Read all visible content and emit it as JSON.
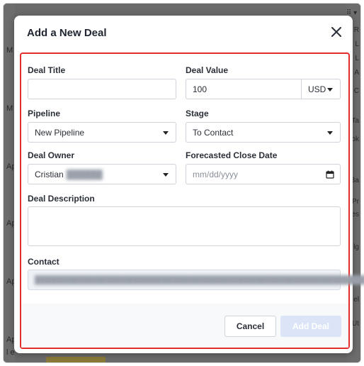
{
  "modal": {
    "title": "Add a New Deal"
  },
  "form": {
    "deal_title": {
      "label": "Deal Title",
      "value": ""
    },
    "deal_value": {
      "label": "Deal Value",
      "value": "100",
      "currency": "USD"
    },
    "pipeline": {
      "label": "Pipeline",
      "value": "New Pipeline"
    },
    "stage": {
      "label": "Stage",
      "value": "To Contact"
    },
    "deal_owner": {
      "label": "Deal Owner",
      "value": "Cristian"
    },
    "close_date": {
      "label": "Forecasted Close Date",
      "placeholder": "mm/dd/yyyy"
    },
    "description": {
      "label": "Deal Description"
    },
    "contact": {
      "label": "Contact"
    }
  },
  "footer": {
    "cancel_label": "Cancel",
    "add_label": "Add Deal"
  },
  "background": {
    "left_items": [
      "M",
      "M",
      "Ap",
      "Ap",
      "Ap",
      "Ap",
      "Ap",
      "l e"
    ],
    "right_items": [
      "⠿ ▾ C",
      "R",
      "L",
      "L",
      "A",
      "A",
      "C",
      "Ta",
      "ok",
      "ck",
      "Ba",
      "Pr",
      "es",
      "lg",
      "el",
      "Ut"
    ]
  },
  "colors": {
    "highlight_border": "#e32c2c",
    "add_button_disabled": "#dbe5f7"
  }
}
